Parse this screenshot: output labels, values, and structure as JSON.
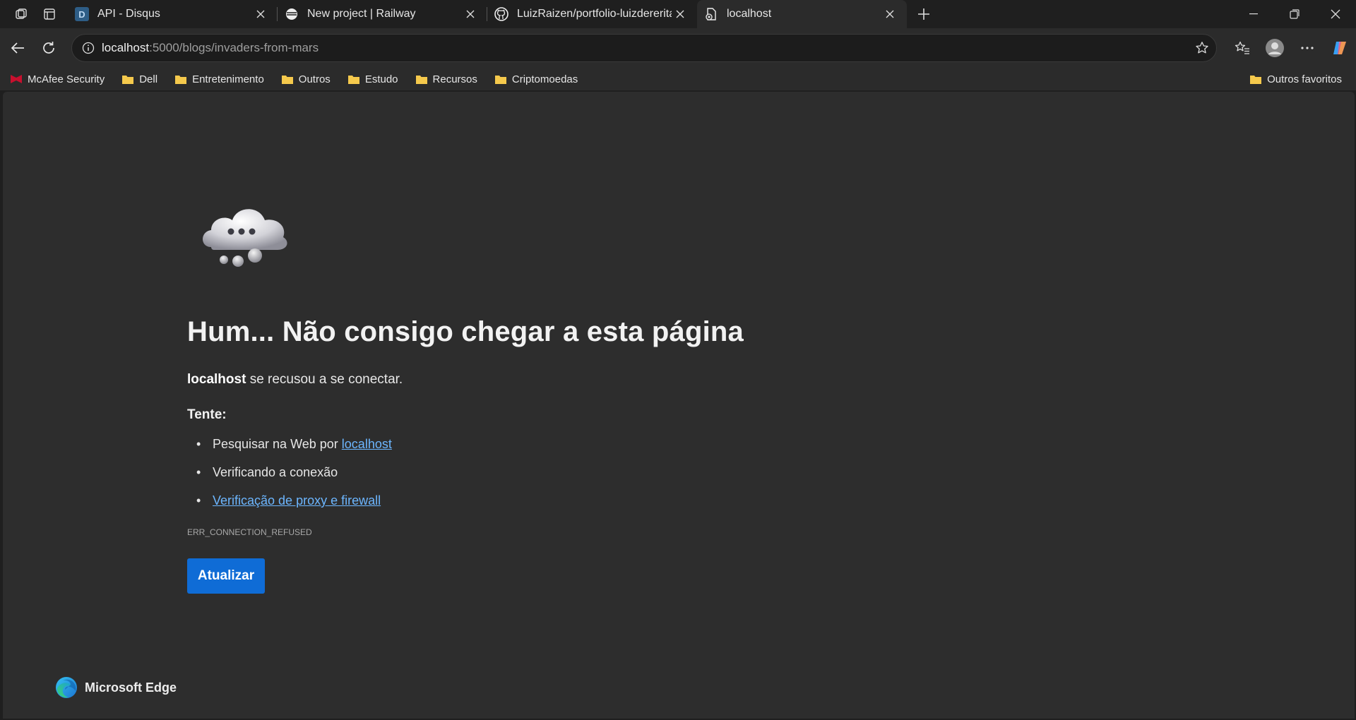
{
  "tabs": [
    {
      "title": "API - Disqus",
      "favicon": "disqus-icon"
    },
    {
      "title": "New project | Railway",
      "favicon": "railway-icon"
    },
    {
      "title": "LuizRaizen/portfolio-luizdererita-c",
      "favicon": "github-icon"
    },
    {
      "title": "localhost",
      "favicon": "error-page-icon",
      "active": true
    }
  ],
  "address_bar": {
    "host": "localhost",
    "rest": ":5000/blogs/invaders-from-mars"
  },
  "bookmarks": [
    {
      "label": "McAfee Security",
      "icon": "mcafee-icon"
    },
    {
      "label": "Dell",
      "icon": "folder-icon"
    },
    {
      "label": "Entretenimento",
      "icon": "folder-icon"
    },
    {
      "label": "Outros",
      "icon": "folder-icon"
    },
    {
      "label": "Estudo",
      "icon": "folder-icon"
    },
    {
      "label": "Recursos",
      "icon": "folder-icon"
    },
    {
      "label": "Criptomoedas",
      "icon": "folder-icon"
    }
  ],
  "other_favorites": "Outros favoritos",
  "error": {
    "title": "Hum... Não consigo chegar a esta página",
    "host": "localhost",
    "message": "se recusou a se conectar.",
    "try_label": "Tente:",
    "suggestion_1_prefix": "Pesquisar na Web por",
    "suggestion_1_link": "localhost",
    "suggestion_2": "Verificando a conexão",
    "suggestion_3_link": "Verificação de proxy e firewall",
    "code": "ERR_CONNECTION_REFUSED",
    "button": "Atualizar"
  },
  "brand": "Microsoft Edge",
  "colors": {
    "accent_button": "#0f6cd6",
    "link": "#6cb6ff",
    "page_bg": "#2d2d2d",
    "chrome_bg": "#1f1f1f",
    "folder": "#f5c94c"
  }
}
